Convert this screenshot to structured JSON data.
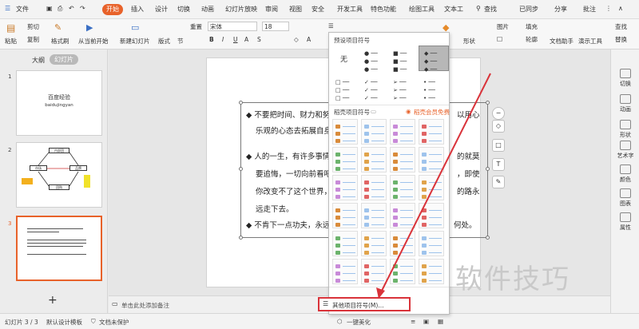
{
  "menubar": {
    "file": "文件",
    "tabs": [
      "开始",
      "插入",
      "设计",
      "切换",
      "动画",
      "幻灯片放映",
      "审阅",
      "视图",
      "安全",
      "开发工具",
      "特色功能",
      "绘图工具",
      "文本工"
    ],
    "search": "查找",
    "sync": "已同步",
    "share": "分享",
    "batch": "批注"
  },
  "ribbon": {
    "paste": "粘贴",
    "cut": "剪切",
    "copy": "复制",
    "format_painter": "格式刷",
    "from_current": "从当前开始",
    "new_slide": "新建幻灯片",
    "layout": "版式",
    "section": "节",
    "reset": "重置",
    "font": "宋体",
    "font_size": "18",
    "shape": "形状",
    "picture": "图片",
    "fill": "填充",
    "outline": "轮廓",
    "doc_helper": "文档助手",
    "presenter": "演示工具",
    "find": "查找",
    "replace": "替换"
  },
  "leftpanel": {
    "tab_outline": "大纲",
    "tab_slides": "幻灯片",
    "slides": [
      {
        "num": "1",
        "title": "百度经验",
        "subtitle": "baidujingyan"
      },
      {
        "num": "2",
        "boxes": [
          "内部团",
          "市场",
          "品牌",
          "团购"
        ]
      },
      {
        "num": "3"
      }
    ],
    "add": "+"
  },
  "slide": {
    "paragraphs": [
      {
        "line1": "◆ 不要把时间、财力和努",
        "line1_right": "以用心",
        "line2": "乐观的心态去拓展自身"
      },
      {
        "line1": "◆ 人的一生，有许多事情",
        "line1_right": "的就莫",
        "line2": "要追悔，一切向前看吧",
        "line2_right": "，即使",
        "line3": "你改变不了这个世界，",
        "line3_right": "的路永",
        "line4": "远走下去。"
      },
      {
        "line1": "◆ 不肯下一点功夫，永远",
        "line1_right": "何处。"
      }
    ]
  },
  "dropdown": {
    "preset_header": "预设项目符号",
    "none_label": "无",
    "stock_header": "稻壳项目符号",
    "member_free": "稻壳会员免费",
    "more": "其他项目符号(M)..."
  },
  "rightbar": {
    "items": [
      "切换",
      "动画",
      "形状",
      "艺术字",
      "颜色",
      "图表",
      "属性"
    ]
  },
  "notes": {
    "placeholder": "单击此处添加备注"
  },
  "status": {
    "slide_info": "幻灯片 3 / 3",
    "template": "默认设计模板",
    "protect": "文档未保护",
    "beautify": "一键美化"
  },
  "watermark": "软件技巧",
  "colors": {
    "accent": "#e8622a",
    "annotation": "#d9333a",
    "grid_line": "#9ec3ec"
  }
}
